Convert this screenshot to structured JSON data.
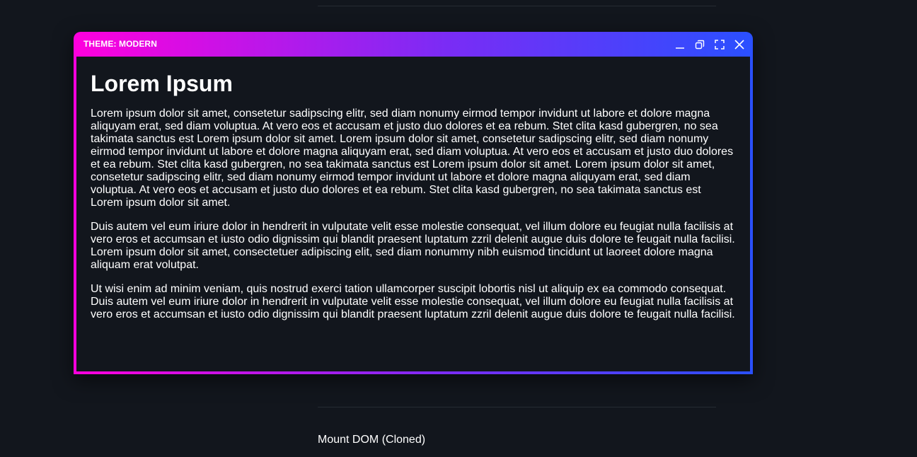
{
  "window": {
    "title": "THEME: MODERN",
    "controls": {
      "minimize_icon": "minimize-icon",
      "restore_icon": "restore-icon",
      "maximize_icon": "fullscreen-icon",
      "close_icon": "close-icon"
    },
    "gradient_colors": [
      "#ff00dd",
      "#7a2cf5",
      "#2a50ff"
    ]
  },
  "content": {
    "heading": "Lorem Ipsum",
    "paragraphs": [
      "Lorem ipsum dolor sit amet, consetetur sadipscing elitr, sed diam nonumy eirmod tempor invidunt ut labore et dolore magna aliquyam erat, sed diam voluptua. At vero eos et accusam et justo duo dolores et ea rebum. Stet clita kasd gubergren, no sea takimata sanctus est Lorem ipsum dolor sit amet. Lorem ipsum dolor sit amet, consetetur sadipscing elitr, sed diam nonumy eirmod tempor invidunt ut labore et dolore magna aliquyam erat, sed diam voluptua. At vero eos et accusam et justo duo dolores et ea rebum. Stet clita kasd gubergren, no sea takimata sanctus est Lorem ipsum dolor sit amet. Lorem ipsum dolor sit amet, consetetur sadipscing elitr, sed diam nonumy eirmod tempor invidunt ut labore et dolore magna aliquyam erat, sed diam voluptua. At vero eos et accusam et justo duo dolores et ea rebum. Stet clita kasd gubergren, no sea takimata sanctus est Lorem ipsum dolor sit amet.",
      "Duis autem vel eum iriure dolor in hendrerit in vulputate velit esse molestie consequat, vel illum dolore eu feugiat nulla facilisis at vero eros et accumsan et iusto odio dignissim qui blandit praesent luptatum zzril delenit augue duis dolore te feugait nulla facilisi. Lorem ipsum dolor sit amet, consectetuer adipiscing elit, sed diam nonummy nibh euismod tincidunt ut laoreet dolore magna aliquam erat volutpat.",
      "Ut wisi enim ad minim veniam, quis nostrud exerci tation ullamcorper suscipit lobortis nisl ut aliquip ex ea commodo consequat. Duis autem vel eum iriure dolor in hendrerit in vulputate velit esse molestie consequat, vel illum dolore eu feugiat nulla facilisis at vero eros et accumsan et iusto odio dignissim qui blandit praesent luptatum zzril delenit augue duis dolore te feugait nulla facilisi."
    ]
  },
  "page": {
    "mount_label": "Mount DOM (Cloned)"
  }
}
